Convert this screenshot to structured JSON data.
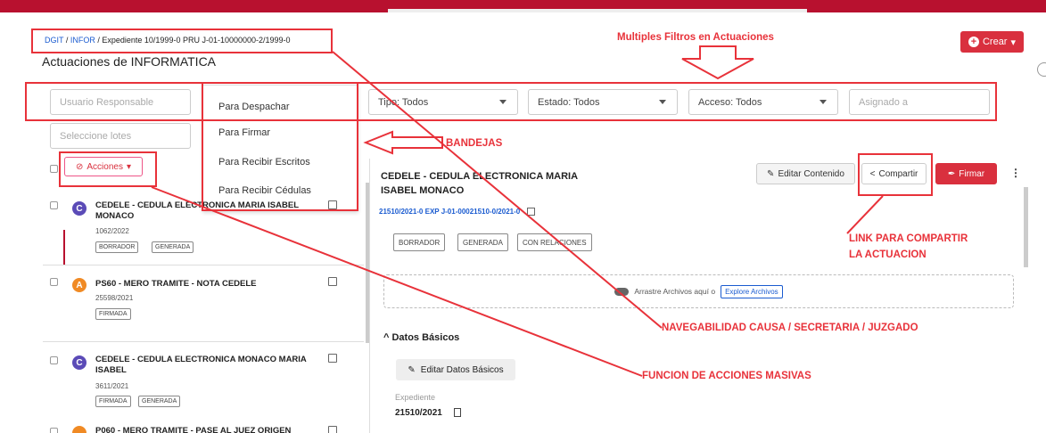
{
  "breadcrumb": {
    "dgit": "DGIT",
    "sep1": " / ",
    "infor": "INFOR",
    "sep2": " / ",
    "expediente": "Expediente 10/1999-0 PRU J-01-10000000-2/1999-0"
  },
  "page_title": "Actuaciones de INFORMATICA",
  "crear_button": "Crear",
  "filters": {
    "usuario_placeholder": "Usuario Responsable",
    "bandeja_selected": "Para Despachar",
    "tipo": "Tipo: Todos",
    "estado": "Estado: Todos",
    "acceso": "Acceso: Todos",
    "asignado_placeholder": "Asignado a",
    "lotes_placeholder": "Seleccione lotes"
  },
  "bandeja_options": [
    "Para Firmar",
    "Para Recibir Escritos",
    "Para Recibir Cédulas"
  ],
  "acciones_button": "Acciones",
  "items": [
    {
      "avatar": "C",
      "title": "CEDELE - CEDULA ELECTRONICA MARIA ISABEL MONACO",
      "number": "1062/2022",
      "badges": [
        "BORRADOR",
        "GENERADA"
      ]
    },
    {
      "avatar": "A",
      "title": "PS60 - MERO TRAMITE - NOTA CEDELE",
      "number": "25598/2021",
      "badges": [
        "FIRMADA"
      ]
    },
    {
      "avatar": "C",
      "title": "CEDELE - CEDULA ELECTRONICA MONACO MARIA ISABEL",
      "number": "3611/2021",
      "badges": [
        "FIRMADA",
        "GENERADA"
      ]
    },
    {
      "avatar": "",
      "title": "P060 - MERO TRAMITE - PASE AL JUEZ ORIGEN",
      "number": "",
      "badges": []
    }
  ],
  "detail": {
    "title": "CEDELE - CEDULA ELECTRONICA MARIA ISABEL MONACO",
    "expediente_link": "21510/2021-0 EXP J-01-00021510-0/2021-0",
    "editar_contenido": "Editar Contenido",
    "compartir": "Compartir",
    "firmar": "Firmar",
    "badges": [
      "BORRADOR",
      "GENERADA",
      "CON RELACIONES"
    ],
    "upload_text": "Arrastre Archivos aquí o",
    "explore_button": "Explore Archivos",
    "section_title": "Datos Básicos",
    "editar_datos": "Editar Datos Básicos",
    "expediente_label": "Expediente",
    "expediente_value": "21510/2021"
  },
  "annotations": {
    "multiples_filtros": "Multiples Filtros en Actuaciones",
    "bandejas": "BANDEJAS",
    "link_compartir_1": "LINK PARA COMPARTIR",
    "link_compartir_2": "LA ACTUACION",
    "navegabilidad": "NAVEGABILIDAD CAUSA / SECRETARIA / JUZGADO",
    "acciones_masivas": "FUNCION DE ACCIONES MASIVAS"
  },
  "colors": {
    "accent": "#d9303e",
    "annotation": "#e8323a",
    "link": "#1a5bd0",
    "topbar": "#b8112f"
  }
}
